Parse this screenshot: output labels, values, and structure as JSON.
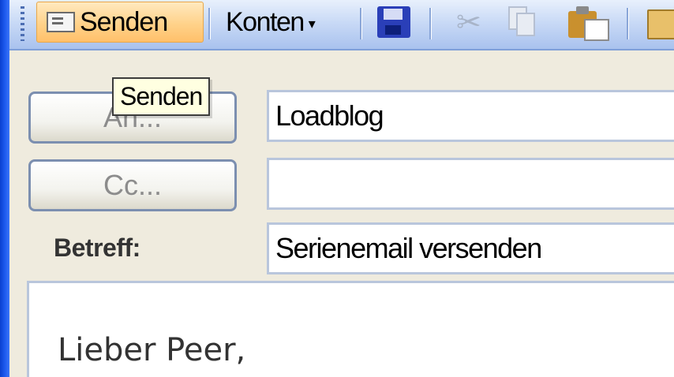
{
  "toolbar": {
    "send_label": "Senden",
    "accounts_label": "Konten",
    "accounts_arrow": "▾",
    "icons": [
      "send-icon",
      "save-icon",
      "cut-icon",
      "copy-icon",
      "paste-icon",
      "attach-icon"
    ]
  },
  "tooltip": {
    "text": "Senden"
  },
  "header": {
    "to_button_label": "An...",
    "cc_button_label": "Cc...",
    "to_value": "Loadblog",
    "cc_value": "",
    "subject_label": "Betreff:",
    "subject_value": "Serienemail versenden"
  },
  "body": {
    "greeting": "Lieber Peer,"
  },
  "colors": {
    "toolbar_blue": "#c9daf6",
    "send_highlight": "#ffd28a",
    "tooltip_bg": "#ffffe1",
    "window_border": "#1f5cf0"
  }
}
